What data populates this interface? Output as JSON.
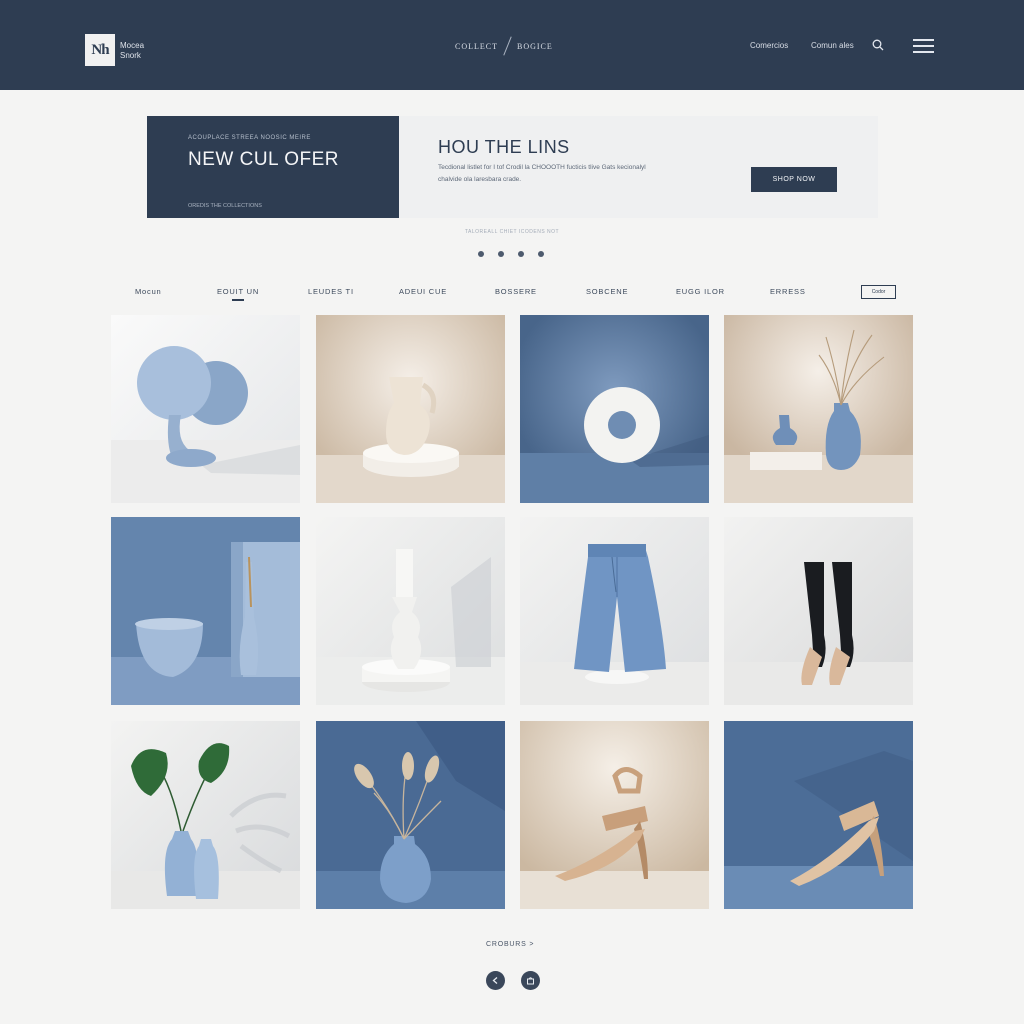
{
  "header": {
    "logo_mark": "Nh",
    "logo_text_line1": "Mocea",
    "logo_text_line2": "Snork",
    "center_left": "COLLECT",
    "center_right": "BOGICE",
    "link1": "Comercios",
    "link2": "Comun ales",
    "icons": [
      "search-icon",
      "menu-icon"
    ]
  },
  "banner": {
    "kicker": "ACOUPLACE STREEA NOOSIC MEIRE",
    "title": "NEW CUL OFER",
    "footnote": "OREDIS THE COLLECTIONS",
    "heading": "HOU THE LINS",
    "description": "Tecdional listlet for I tof Crodil la CHOOOTH fucticis tlive Gats kecionalyl chalvide ola laresbara crade.",
    "cta_label": "SHOP NOW"
  },
  "carousel": {
    "caption": "TALOREALL CHIET ICODENS NOT",
    "dots": 4,
    "active_dot": 0
  },
  "categories": {
    "items": [
      "Mocun",
      "EOUIT UN",
      "LEUDES TI",
      "ADEUI CUE",
      "BOSSERE",
      "SOBCENE",
      "EUGG ILOR",
      "ERRESS"
    ],
    "active_index": 1,
    "filter_label": "Codor"
  },
  "products": [
    {
      "name": "blue-mushroom-sculpture"
    },
    {
      "name": "cream-pitcher-vase"
    },
    {
      "name": "white-donut-sculpture"
    },
    {
      "name": "blue-vase-set-with-pampas"
    },
    {
      "name": "blue-bowl-and-vase"
    },
    {
      "name": "white-candlestick"
    },
    {
      "name": "blue-wide-leg-trousers"
    },
    {
      "name": "black-socks-nude-heels"
    },
    {
      "name": "blue-vases-with-monstera"
    },
    {
      "name": "blue-vase-with-pampas"
    },
    {
      "name": "beige-ankle-strap-heel"
    },
    {
      "name": "beige-strap-pump"
    }
  ],
  "pagination": {
    "link_label": "CROBURS >",
    "icons": [
      "previous-icon",
      "bag-icon"
    ]
  },
  "colors": {
    "navy": "#2e3d52",
    "dusty_blue": "#5f7fa6",
    "sand": "#d8cab9",
    "page": "#f4f4f3"
  }
}
